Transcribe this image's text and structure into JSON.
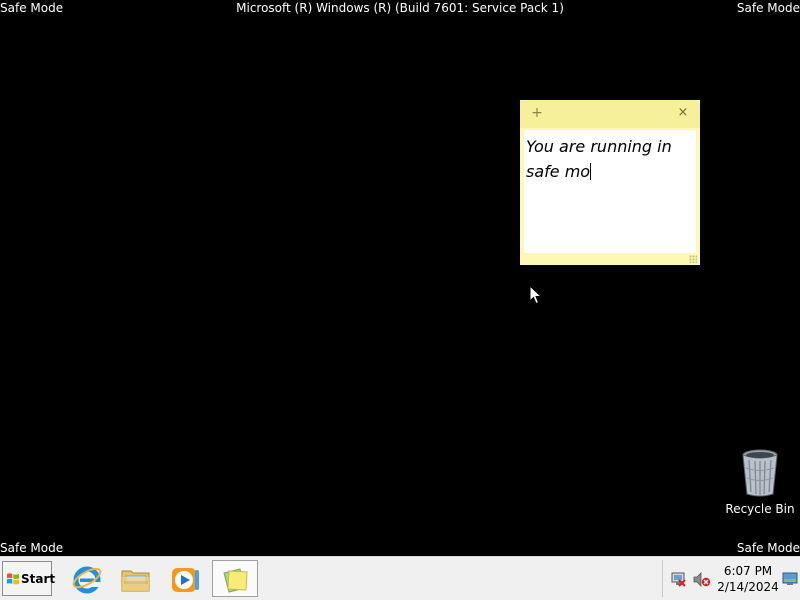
{
  "desktop": {
    "safe_mode_top_left": "Safe Mode",
    "safe_mode_top_right": "Safe Mode",
    "safe_mode_bottom_left": "Safe Mode",
    "safe_mode_bottom_right": "Safe Mode",
    "build_text": "Microsoft (R) Windows (R) (Build 7601: Service Pack 1)",
    "background_color": "#000000"
  },
  "sticky_note": {
    "add_icon": "plus-icon",
    "add_glyph": "+",
    "close_icon": "close-icon",
    "close_glyph": "×",
    "text": "You are running in safe mo",
    "color": "#fdf8b4"
  },
  "desktop_icons": {
    "recycle_bin_label": "Recycle Bin",
    "recycle_bin_icon": "recycle-bin-icon"
  },
  "taskbar": {
    "start_label": "Start",
    "pinned": [
      {
        "name": "Internet Explorer",
        "icon": "internet-explorer-icon"
      },
      {
        "name": "Windows Explorer",
        "icon": "folder-icon"
      },
      {
        "name": "Windows Media Player",
        "icon": "media-player-icon"
      },
      {
        "name": "Sticky Notes",
        "icon": "sticky-notes-icon",
        "active": true
      }
    ],
    "tray": {
      "network_icon": "network-disconnected-icon",
      "volume_icon": "volume-muted-icon",
      "time": "6:07 PM",
      "date": "2/14/2024",
      "show_desktop_icon": "show-desktop-icon"
    }
  }
}
